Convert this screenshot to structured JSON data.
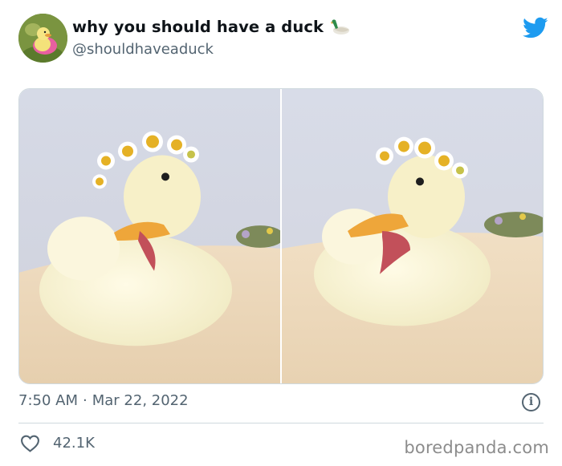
{
  "tweet": {
    "display_name": "why you should have a duck",
    "handle": "@shouldhaveaduck",
    "time": "7:50 AM",
    "separator": "·",
    "date": "Mar 22, 2022",
    "likes": "42.1K"
  },
  "icons": {
    "name_emoji": "duck-emoji-icon",
    "platform": "twitter-bird-icon",
    "info": "info-icon",
    "like": "heart-icon"
  },
  "watermark": "boredpanda.com",
  "colors": {
    "twitter_blue": "#1d9bf0",
    "text_primary": "#0f1419",
    "text_secondary": "#536471",
    "border": "#cfd9de",
    "watermark": "#8c8c8c"
  }
}
